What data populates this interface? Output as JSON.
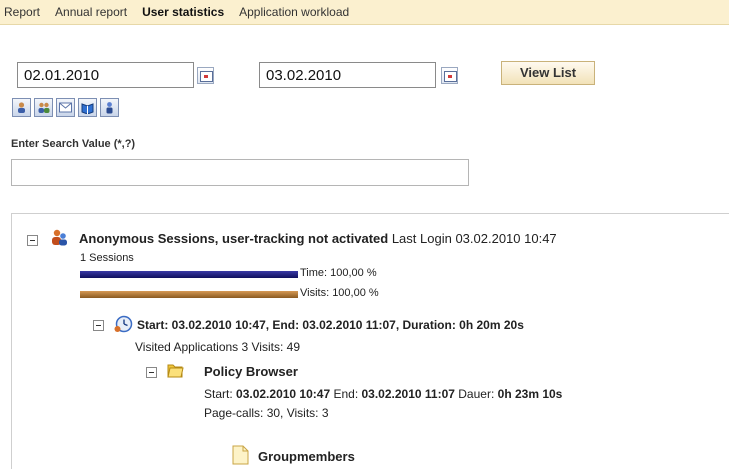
{
  "tabs": [
    {
      "label": "Report"
    },
    {
      "label": "Annual report"
    },
    {
      "label": "User statistics"
    },
    {
      "label": "Application workload"
    }
  ],
  "filters": {
    "date_from": "02.01.2010",
    "date_to": "03.02.2010",
    "view_button": "View List"
  },
  "toolbar_icons": [
    "user-icon",
    "users-group-icon",
    "mail-icon",
    "book-icon",
    "person-icon"
  ],
  "search": {
    "label": "Enter Search Value (*,?)",
    "value": ""
  },
  "tree": {
    "root": {
      "title": "Anonymous Sessions, user-tracking not activated",
      "last_login_label": "Last Login",
      "last_login": "03.02.2010 10:47",
      "sessions": "1 Sessions",
      "time_label": "Time: 100,00 %",
      "visits_label": "Visits: 100,00 %",
      "time_pct": 100,
      "visits_pct": 100
    },
    "session": {
      "title": "Start: 03.02.2010 10:47, End: 03.02.2010 11:07, Duration: 0h 20m 20s",
      "summary": "Visited Applications 3 Visits: 49"
    },
    "app": {
      "name": "Policy Browser",
      "start_label": "Start:",
      "start": "03.02.2010 10:47",
      "end_label": "End:",
      "end": "03.02.2010 11:07",
      "duration_label": "Dauer:",
      "duration": "0h 23m 10s",
      "pagecalls": "Page-calls: 30, Visits: 3"
    },
    "sub_item": "Groupmembers"
  },
  "colors": {
    "tab_bar": "#fbf0cf",
    "bar_time": "#1c1c7a",
    "bar_visits": "#a86e2e"
  }
}
